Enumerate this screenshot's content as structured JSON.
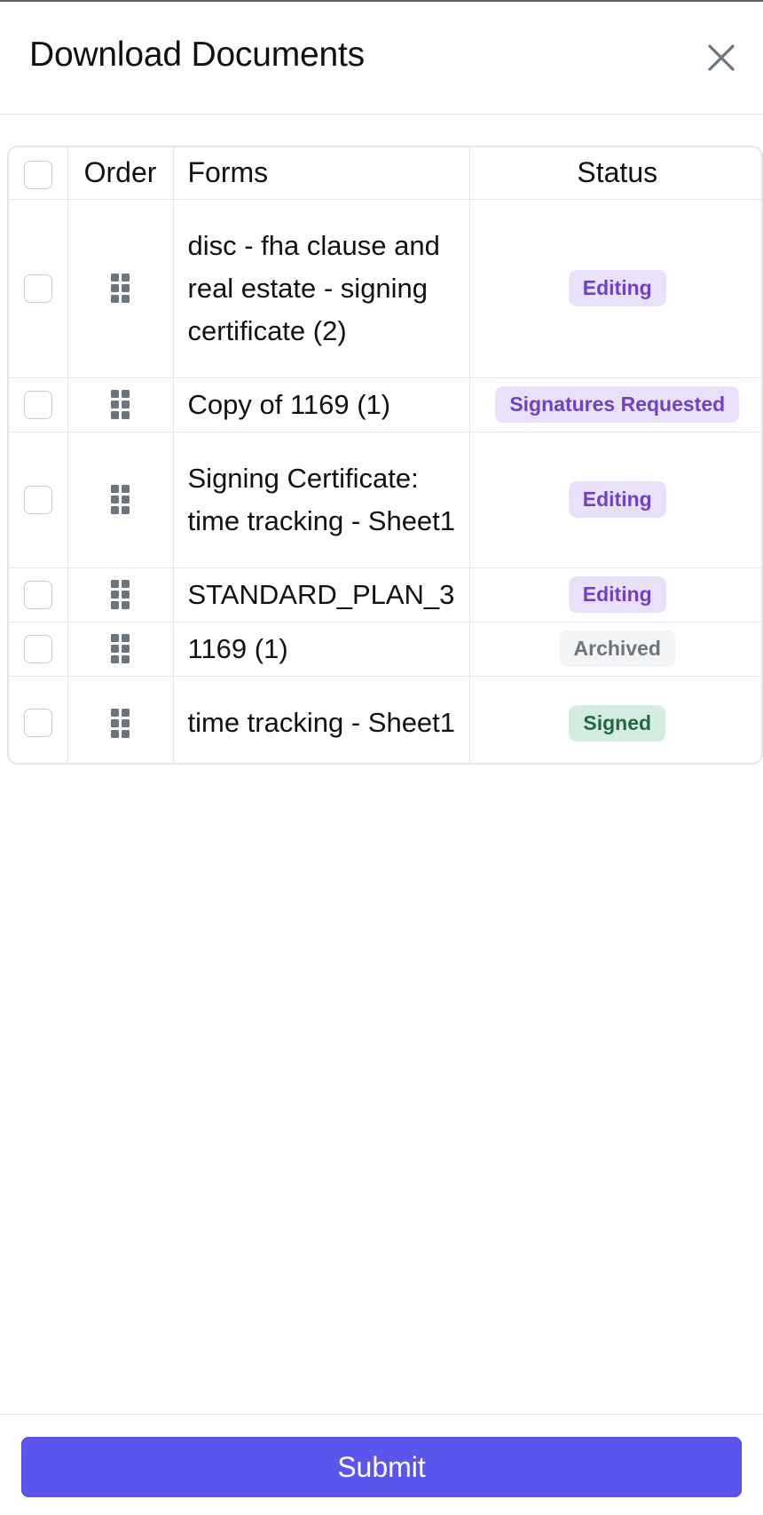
{
  "modal": {
    "title": "Download Documents",
    "close_icon": "close-icon"
  },
  "table": {
    "columns": {
      "select_all": "",
      "order": "Order",
      "forms": "Forms",
      "status": "Status"
    },
    "rows": [
      {
        "form": "disc - fha clause and real estate - signing certificate (2)",
        "status": "Editing",
        "status_color": "#6f42c1",
        "checked": false
      },
      {
        "form": "Copy of 1169 (1)",
        "status": "Signatures Requested",
        "status_color": "#6f42c1",
        "checked": false
      },
      {
        "form": "Signing Certificate: time tracking - Sheet1",
        "status": "Editing",
        "status_color": "#6f42c1",
        "checked": false
      },
      {
        "form": "STANDARD_PLAN_3",
        "status": "Editing",
        "status_color": "#6f42c1",
        "checked": false
      },
      {
        "form": "1169 (1)",
        "status": "Archived",
        "status_color": "#6c757d",
        "checked": false
      },
      {
        "form": "time tracking - Sheet1",
        "status": "Signed",
        "status_color": "#1d6b40",
        "checked": false
      }
    ],
    "drag_icon": "drag-handle-icon"
  },
  "footer": {
    "submit_label": "Submit",
    "accent_color": "#5a55ec"
  }
}
